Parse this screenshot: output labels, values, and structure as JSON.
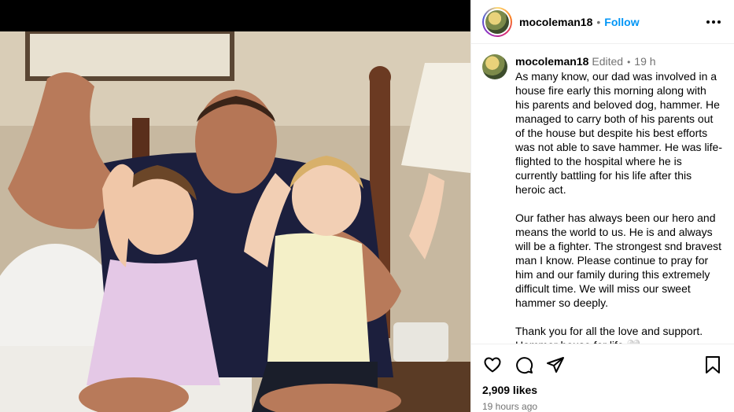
{
  "post": {
    "username": "mocoleman18",
    "follow_label": "Follow",
    "separator": "•"
  },
  "caption": {
    "username": "mocoleman18",
    "edited": "Edited",
    "separator": "•",
    "time": "19 h",
    "paragraphs": [
      "As many know, our dad was involved in a house fire early this morning along with his parents and beloved dog, hammer. He managed to carry both of his parents out of the house but despite his best efforts was not able to save hammer. He was life-flighted to the hospital where he is currently battling for his life after this heroic act.",
      "Our father has always been our hero and means the world to us. He is and always will be a fighter. The strongest snd bravest man I know. Please continue to pray for him and our family during this extremely difficult time. We will miss our sweet hammer so deeply.",
      "Thank you for all the love and support. Hammer house for life 🤍"
    ]
  },
  "stats": {
    "likes": "2,909 likes",
    "posted": "19 hours ago"
  },
  "icons": {
    "like": "heart-icon",
    "comment": "comment-icon",
    "share": "share-icon",
    "save": "bookmark-icon",
    "more": "more-options-icon"
  },
  "colors": {
    "follow": "#0095f6",
    "muted": "#737373",
    "divider": "#efefef"
  }
}
